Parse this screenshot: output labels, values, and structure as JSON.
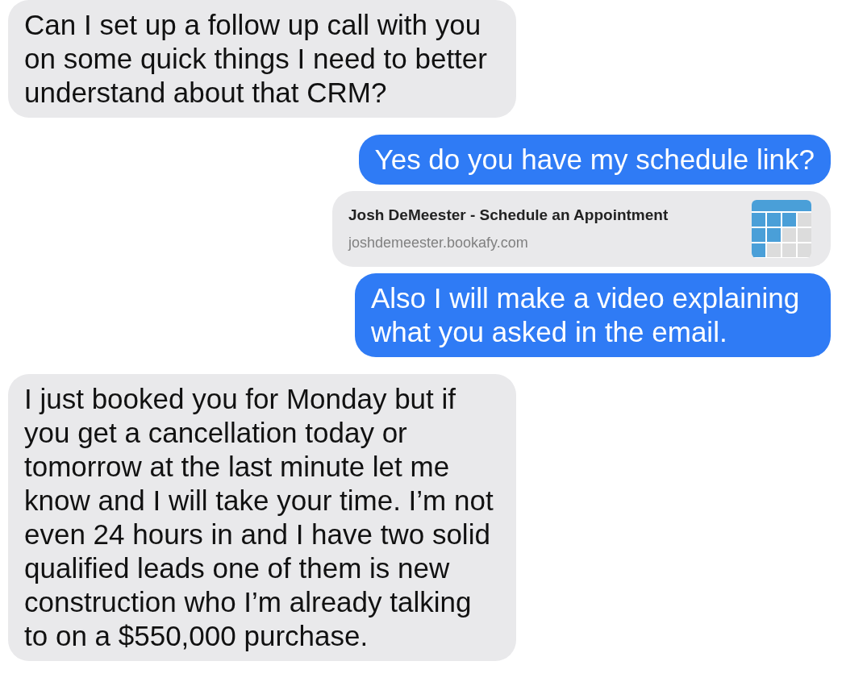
{
  "messages": [
    {
      "kind": "text",
      "outgoing": false,
      "text": "Can I set up a follow up call with you on some quick things I need to better understand about that CRM?"
    },
    {
      "kind": "text",
      "outgoing": true,
      "text": "Yes do you have my schedule link?"
    },
    {
      "kind": "link",
      "outgoing": true,
      "title": "Josh DeMeester - Schedule an Appointment",
      "url": "joshdemeester.bookafy.com"
    },
    {
      "kind": "text",
      "outgoing": true,
      "text": "Also I will make a video explaining what you asked in the email."
    },
    {
      "kind": "text",
      "outgoing": false,
      "text": "I just booked you for Monday but if you get a cancellation today or tomorrow at the last minute let me know and I will take your time. I’m not even 24 hours in and I have two solid qualified leads one of them is new construction who I’m already talking to on a $550,000 purchase."
    }
  ]
}
